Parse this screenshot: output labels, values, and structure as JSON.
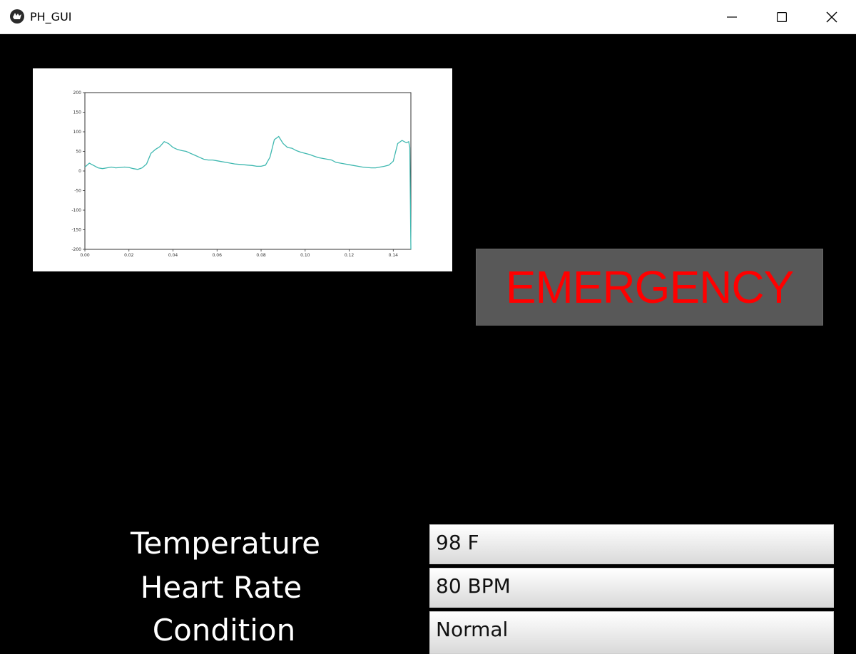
{
  "window": {
    "title": "PH_GUI"
  },
  "chart_data": {
    "type": "line",
    "x_ticks": [
      "0.00",
      "0.02",
      "0.04",
      "0.06",
      "0.08",
      "0.10",
      "0.12",
      "0.14"
    ],
    "y_ticks": [
      "200",
      "150",
      "100",
      "50",
      "0",
      "-50",
      "-100",
      "-150",
      "-200"
    ],
    "xlim": [
      0.0,
      0.148
    ],
    "ylim": [
      -200,
      200
    ],
    "series": [
      {
        "color": "#3fb8b0",
        "x": [
          0.0,
          0.002,
          0.004,
          0.006,
          0.008,
          0.01,
          0.012,
          0.014,
          0.016,
          0.018,
          0.02,
          0.022,
          0.024,
          0.026,
          0.028,
          0.03,
          0.032,
          0.034,
          0.036,
          0.038,
          0.04,
          0.042,
          0.044,
          0.046,
          0.048,
          0.05,
          0.052,
          0.054,
          0.056,
          0.058,
          0.06,
          0.062,
          0.064,
          0.066,
          0.068,
          0.07,
          0.072,
          0.074,
          0.076,
          0.078,
          0.08,
          0.082,
          0.084,
          0.086,
          0.088,
          0.09,
          0.092,
          0.094,
          0.096,
          0.098,
          0.1,
          0.102,
          0.104,
          0.106,
          0.108,
          0.11,
          0.112,
          0.114,
          0.116,
          0.118,
          0.12,
          0.122,
          0.124,
          0.126,
          0.128,
          0.13,
          0.132,
          0.134,
          0.136,
          0.138,
          0.14,
          0.142,
          0.144,
          0.146,
          0.147,
          0.1475,
          0.148
        ],
        "y": [
          10,
          20,
          14,
          8,
          6,
          8,
          10,
          8,
          9,
          10,
          9,
          6,
          4,
          8,
          18,
          45,
          55,
          62,
          75,
          70,
          60,
          55,
          52,
          50,
          45,
          40,
          35,
          30,
          28,
          28,
          26,
          24,
          22,
          20,
          18,
          17,
          16,
          15,
          14,
          12,
          12,
          15,
          35,
          80,
          88,
          70,
          60,
          58,
          52,
          48,
          45,
          42,
          38,
          34,
          32,
          30,
          28,
          22,
          20,
          18,
          16,
          14,
          12,
          10,
          9,
          8,
          8,
          10,
          12,
          15,
          25,
          70,
          78,
          72,
          75,
          60,
          -200
        ]
      }
    ]
  },
  "alert": {
    "label": "EMERGENCY",
    "color": "#ff0000"
  },
  "vitals": {
    "temperature_label": "Temperature",
    "temperature_value": "98 F",
    "heart_rate_label": "Heart Rate",
    "heart_rate_value": "80 BPM",
    "condition_label": "Condition",
    "condition_value": "Normal"
  }
}
